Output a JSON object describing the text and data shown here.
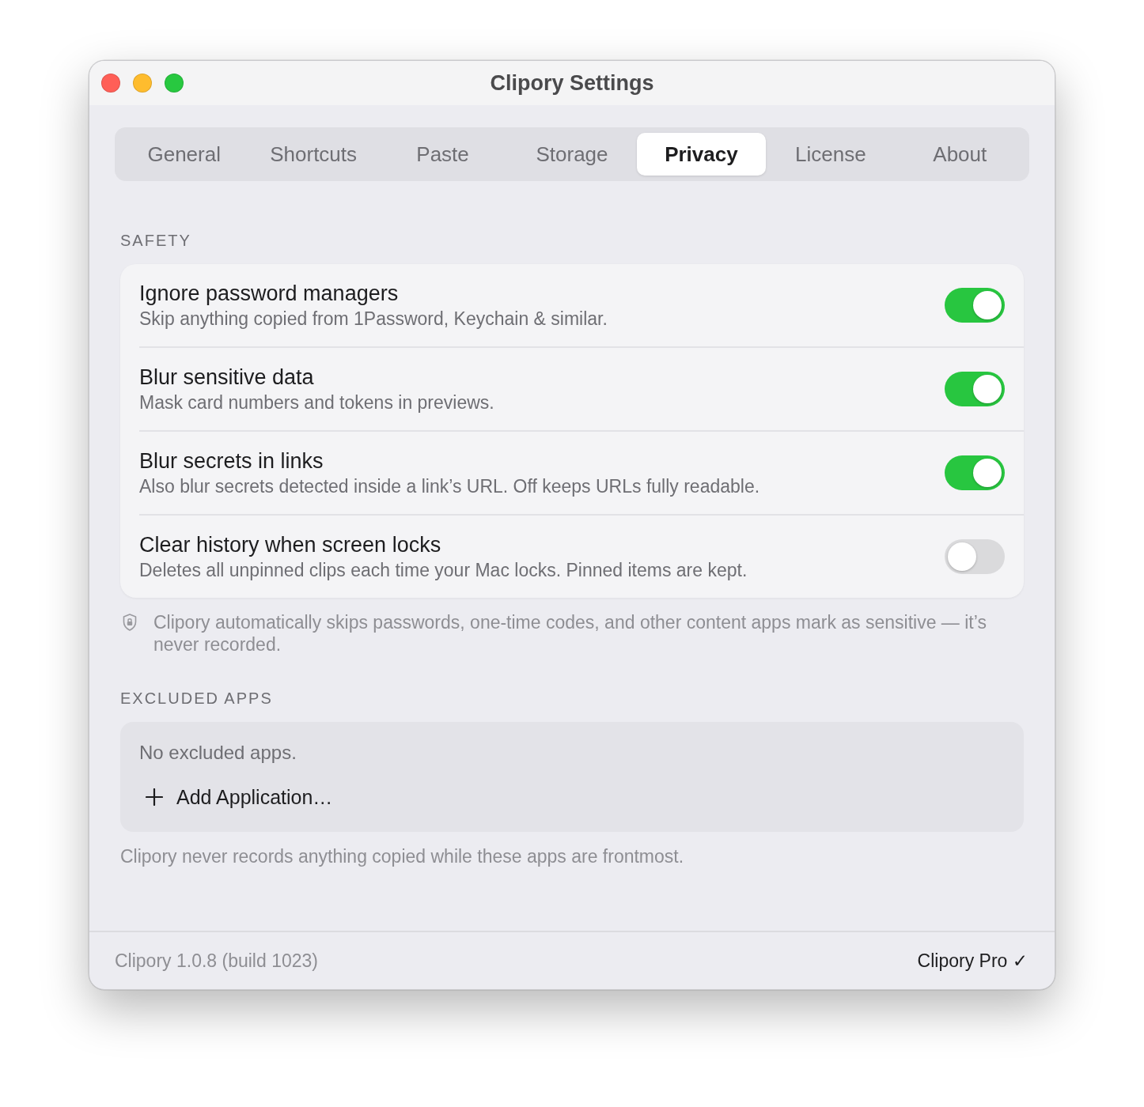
{
  "window": {
    "title": "Clipory Settings"
  },
  "tabs": [
    {
      "label": "General",
      "selected": false
    },
    {
      "label": "Shortcuts",
      "selected": false
    },
    {
      "label": "Paste",
      "selected": false
    },
    {
      "label": "Storage",
      "selected": false
    },
    {
      "label": "Privacy",
      "selected": true
    },
    {
      "label": "License",
      "selected": false
    },
    {
      "label": "About",
      "selected": false
    }
  ],
  "safety": {
    "heading": "SAFETY",
    "items": [
      {
        "title": "Ignore password managers",
        "description": "Skip anything copied from 1Password, Keychain & similar.",
        "on": true
      },
      {
        "title": "Blur sensitive data",
        "description": "Mask card numbers and tokens in previews.",
        "on": true
      },
      {
        "title": "Blur secrets in links",
        "description": "Also blur secrets detected inside a link’s URL. Off keeps URLs fully readable.",
        "on": true
      },
      {
        "title": "Clear history when screen locks",
        "description": "Deletes all unpinned clips each time your Mac locks. Pinned items are kept.",
        "on": false
      }
    ],
    "note": "Clipory automatically skips passwords, one-time codes, and other content apps mark as sensitive — it’s never recorded."
  },
  "excluded_apps": {
    "heading": "EXCLUDED APPS",
    "empty_text": "No excluded apps.",
    "add_button": "Add Application…",
    "footnote": "Clipory never records anything copied while these apps are frontmost."
  },
  "status_bar": {
    "version": "Clipory 1.0.8 (build 1023)",
    "license": "Clipory Pro ✓"
  }
}
